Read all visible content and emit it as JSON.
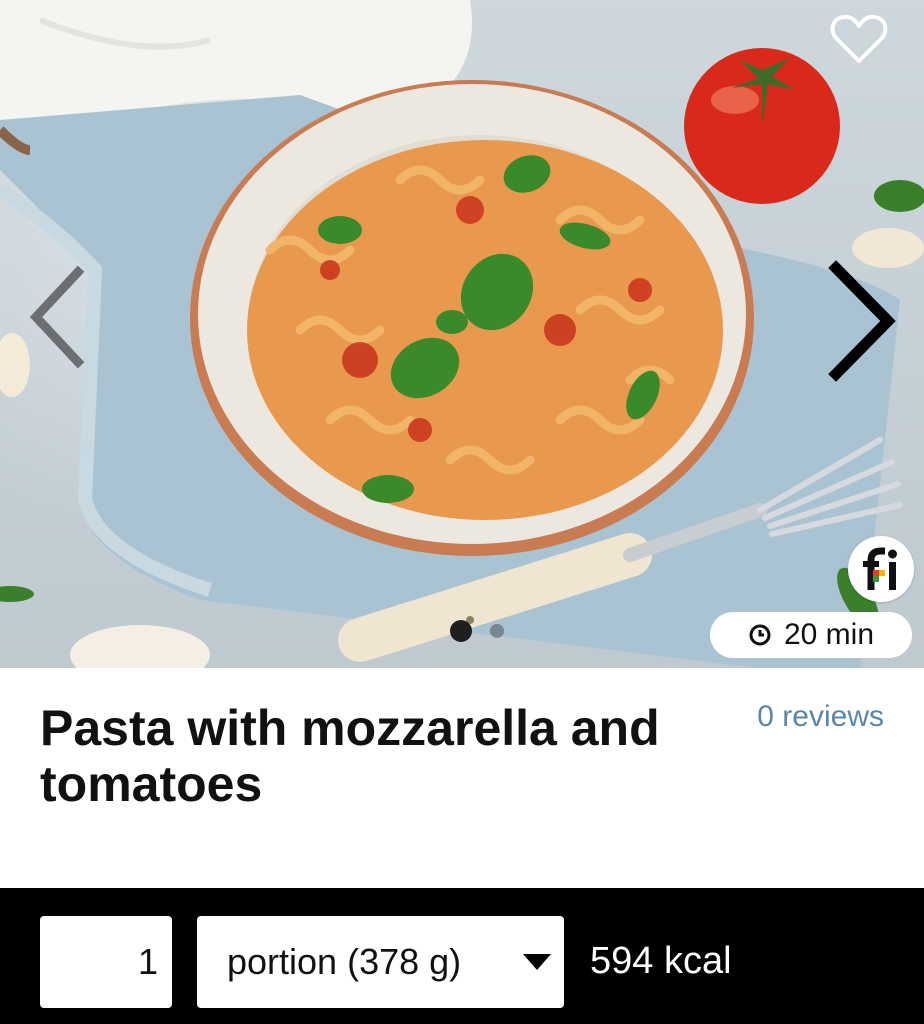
{
  "recipe": {
    "title": "Pasta with mozzarella and tomatoes",
    "reviews_label": "0 reviews",
    "cook_time": "20 min"
  },
  "gallery": {
    "favorite_icon": "heart-outline-icon",
    "prev_icon": "chevron-left-icon",
    "next_icon": "chevron-right-icon",
    "brand_badge_text": "fi",
    "total_images": 2,
    "active_image": 1
  },
  "nutrition": {
    "quantity": "1",
    "unit": "portion (378 g)",
    "calories": "594 kcal"
  },
  "colors": {
    "reviews_link": "#5a87a8",
    "bottom_bar": "#000000",
    "brand_red": "#e53935",
    "brand_green": "#2e9d3c",
    "brand_yellow": "#f5b800"
  }
}
